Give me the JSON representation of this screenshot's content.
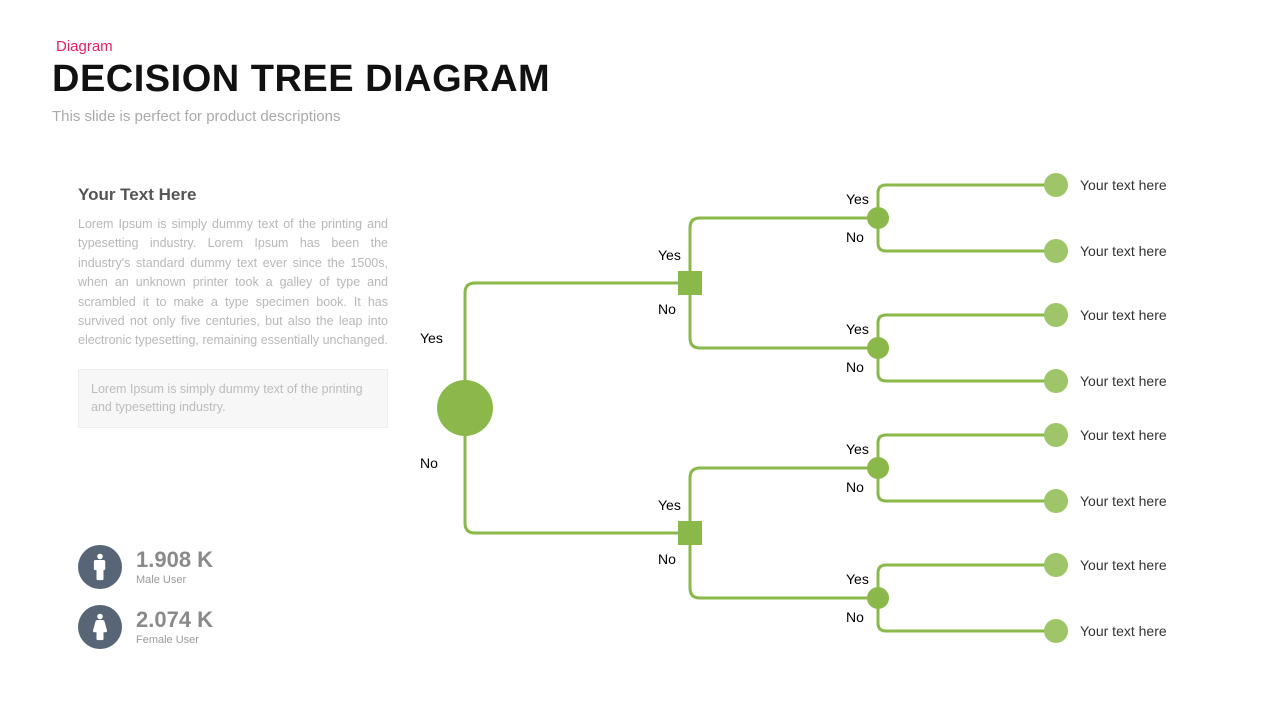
{
  "header": {
    "eyebrow": "Diagram",
    "title": "DECISION TREE DIAGRAM",
    "subtitle": "This slide is perfect for product descriptions"
  },
  "side": {
    "heading": "Your Text Here",
    "body": "Lorem Ipsum is simply dummy text of the printing and typesetting industry. Lorem Ipsum has been the industry's standard dummy text ever since the 1500s, when an unknown printer took a galley of type and scrambled it to make a type specimen book. It has survived not only five centuries, but also the leap into electronic typesetting, remaining essentially unchanged.",
    "callout": "Lorem Ipsum is simply dummy text of the printing and typesetting industry."
  },
  "stats": {
    "male": {
      "value": "1.908 K",
      "label": "Male User"
    },
    "female": {
      "value": "2.074 K",
      "label": "Female User"
    }
  },
  "labels": {
    "yes": "Yes",
    "no": "No"
  },
  "leaves": [
    "Your text here",
    "Your text here",
    "Your text here",
    "Your text here",
    "Your text here",
    "Your text here",
    "Your text here",
    "Your text here"
  ],
  "chart_data": {
    "type": "decision-tree",
    "root": {
      "shape": "circle",
      "branches": [
        "Yes",
        "No"
      ]
    },
    "level2": [
      {
        "shape": "square",
        "branches": [
          "Yes",
          "No"
        ]
      },
      {
        "shape": "square",
        "branches": [
          "Yes",
          "No"
        ]
      }
    ],
    "level3": [
      {
        "shape": "circle",
        "branches": [
          "Yes",
          "No"
        ]
      },
      {
        "shape": "circle",
        "branches": [
          "Yes",
          "No"
        ]
      },
      {
        "shape": "circle",
        "branches": [
          "Yes",
          "No"
        ]
      },
      {
        "shape": "circle",
        "branches": [
          "Yes",
          "No"
        ]
      }
    ],
    "leaf_count": 8
  }
}
